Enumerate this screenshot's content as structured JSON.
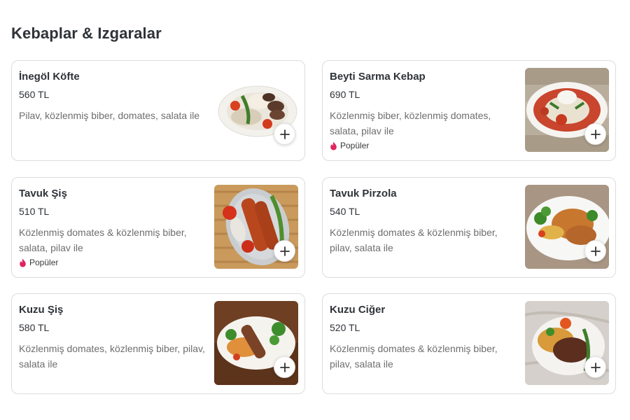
{
  "section": {
    "title": "Kebaplar & Izgaralar"
  },
  "items": [
    {
      "name": "İnegöl Köfte",
      "price": "560 TL",
      "description": "Pilav, közlenmiş biber, domates, salata ile",
      "badge": ""
    },
    {
      "name": "Beyti Sarma Kebap",
      "price": "690 TL",
      "description": "Közlenmiş biber, közlenmiş domates, salata, pilav ile",
      "badge": "Popüler"
    },
    {
      "name": "Tavuk Şiş",
      "price": "510 TL",
      "description": "Közlenmiş domates & közlenmiş biber, salata, pilav ile",
      "badge": "Popüler"
    },
    {
      "name": "Tavuk Pirzola",
      "price": "540 TL",
      "description": "Közlenmiş domates & közlenmiş biber, pilav, salata ile",
      "badge": ""
    },
    {
      "name": "Kuzu Şiş",
      "price": "580 TL",
      "description": "Közlenmiş domates, közlenmiş biber, pilav, salata ile",
      "badge": ""
    },
    {
      "name": "Kuzu Ciğer",
      "price": "520 TL",
      "description": "Közlenmiş domates & közlenmiş biber, pilav, salata ile",
      "badge": ""
    }
  ],
  "icons": {
    "add": "plus-icon",
    "popular": "flame-icon"
  },
  "colors": {
    "popular_flame": "#e0245e",
    "card_border": "#dcdcdc"
  }
}
